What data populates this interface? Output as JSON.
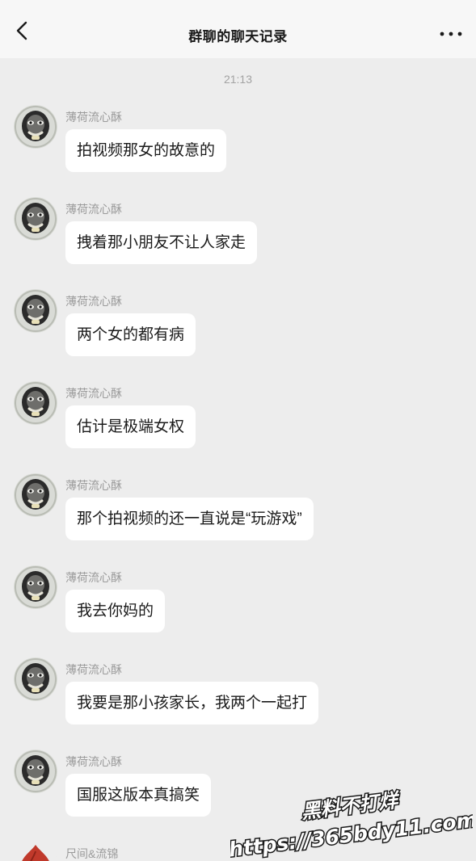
{
  "navbar": {
    "title": "群聊的聊天记录"
  },
  "timestamp": "21:13",
  "messages": [
    {
      "sender": "薄荷流心酥",
      "text": "拍视频那女的故意的"
    },
    {
      "sender": "薄荷流心酥",
      "text": "拽着那小朋友不让人家走"
    },
    {
      "sender": "薄荷流心酥",
      "text": "两个女的都有病"
    },
    {
      "sender": "薄荷流心酥",
      "text": "估计是极端女权"
    },
    {
      "sender": "薄荷流心酥",
      "text": "那个拍视频的还一直说是“玩游戏”"
    },
    {
      "sender": "薄荷流心酥",
      "text": "我去你妈的"
    },
    {
      "sender": "薄荷流心酥",
      "text": "我要是那小孩家长，我两个一起打"
    },
    {
      "sender": "薄荷流心酥",
      "text": "国服这版本真搞笑"
    },
    {
      "sender": "尺间&流锦"
    }
  ],
  "watermark": {
    "line1": "黑料不打烊",
    "line2": "https://365bdy11.com"
  },
  "colors": {
    "background": "#ededed",
    "navbar": "#f7f7f7",
    "bubble": "#ffffff",
    "sender_text": "#9b9b9b",
    "watermark_text": "#ffffff",
    "watermark_outline": "#1a1a1a"
  },
  "icons": {
    "back": "chevron-left-icon",
    "more": "more-dots-icon"
  }
}
